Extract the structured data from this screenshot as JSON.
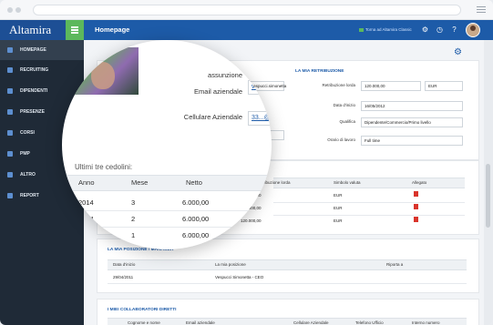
{
  "app": {
    "logo_text": "Altamira",
    "page_title": "Homepage",
    "back_link": "Torna ad Altamira Classic"
  },
  "sidebar": {
    "items": [
      {
        "label": "Homepage"
      },
      {
        "label": "Recruiting"
      },
      {
        "label": "Dipendenti"
      },
      {
        "label": "Presenze"
      },
      {
        "label": "Corsi"
      },
      {
        "label": "PMP"
      },
      {
        "label": "Altro"
      },
      {
        "label": "Report"
      }
    ]
  },
  "profile_zoom": {
    "fields": [
      {
        "label": "assunzione",
        "value": ""
      },
      {
        "label": "Email aziendale",
        "value": "vespucci.simonetta"
      },
      {
        "label": "Cellulare Aziendale",
        "value": "33...@...com"
      }
    ]
  },
  "retribuzione": {
    "title": "La mia retribuzione",
    "retribuzione_lorda_label": "Retribuzione lorda",
    "retribuzione_lorda_value": "120.000,00",
    "valuta_value": "EUR",
    "data_inizio_label": "Data d'inizio",
    "data_inizio_value": "16/05/2012",
    "qualifica_label": "Qualifica",
    "qualifica_value": "Dipendente/Commercio/Primo livello",
    "orario_label": "Orario di lavoro",
    "orario_value": "Full time"
  },
  "cedolini": {
    "title": "Ultimi tre cedolini:",
    "headers": [
      "Anno",
      "Mese",
      "Netto",
      "Retribuzione lorda",
      "Simbolo valuta",
      "Allegato"
    ],
    "rows": [
      {
        "anno": "2014",
        "mese": "3",
        "netto": "6.000,00",
        "lordo": "120.000,00",
        "valuta": "EUR"
      },
      {
        "anno": "2014",
        "mese": "2",
        "netto": "6.000,00",
        "lordo": "120.000,00",
        "valuta": "EUR"
      },
      {
        "anno": "2014",
        "mese": "1",
        "netto": "6.000,00",
        "lordo": "120.000,00",
        "valuta": "EUR"
      }
    ]
  },
  "posizione": {
    "title": "La mia posizione / Manager",
    "headers": [
      "Data d'inizio",
      "La mia posizione",
      "Riporta a"
    ],
    "rows": [
      {
        "data": "29/04/2011",
        "posizione": "Vespucci Simonetta - CEO",
        "riporta": ""
      }
    ]
  },
  "collaboratori": {
    "title": "I miei collaboratori diretti",
    "headers": [
      "Cognome e nome",
      "Email aziendale",
      "Cellulare Aziendale",
      "Telefono Ufficio",
      "Interno numero"
    ]
  },
  "colors": {
    "brand": "#1d5ba8",
    "sidebar": "#1f2a37",
    "accent_green": "#5cb85c"
  }
}
